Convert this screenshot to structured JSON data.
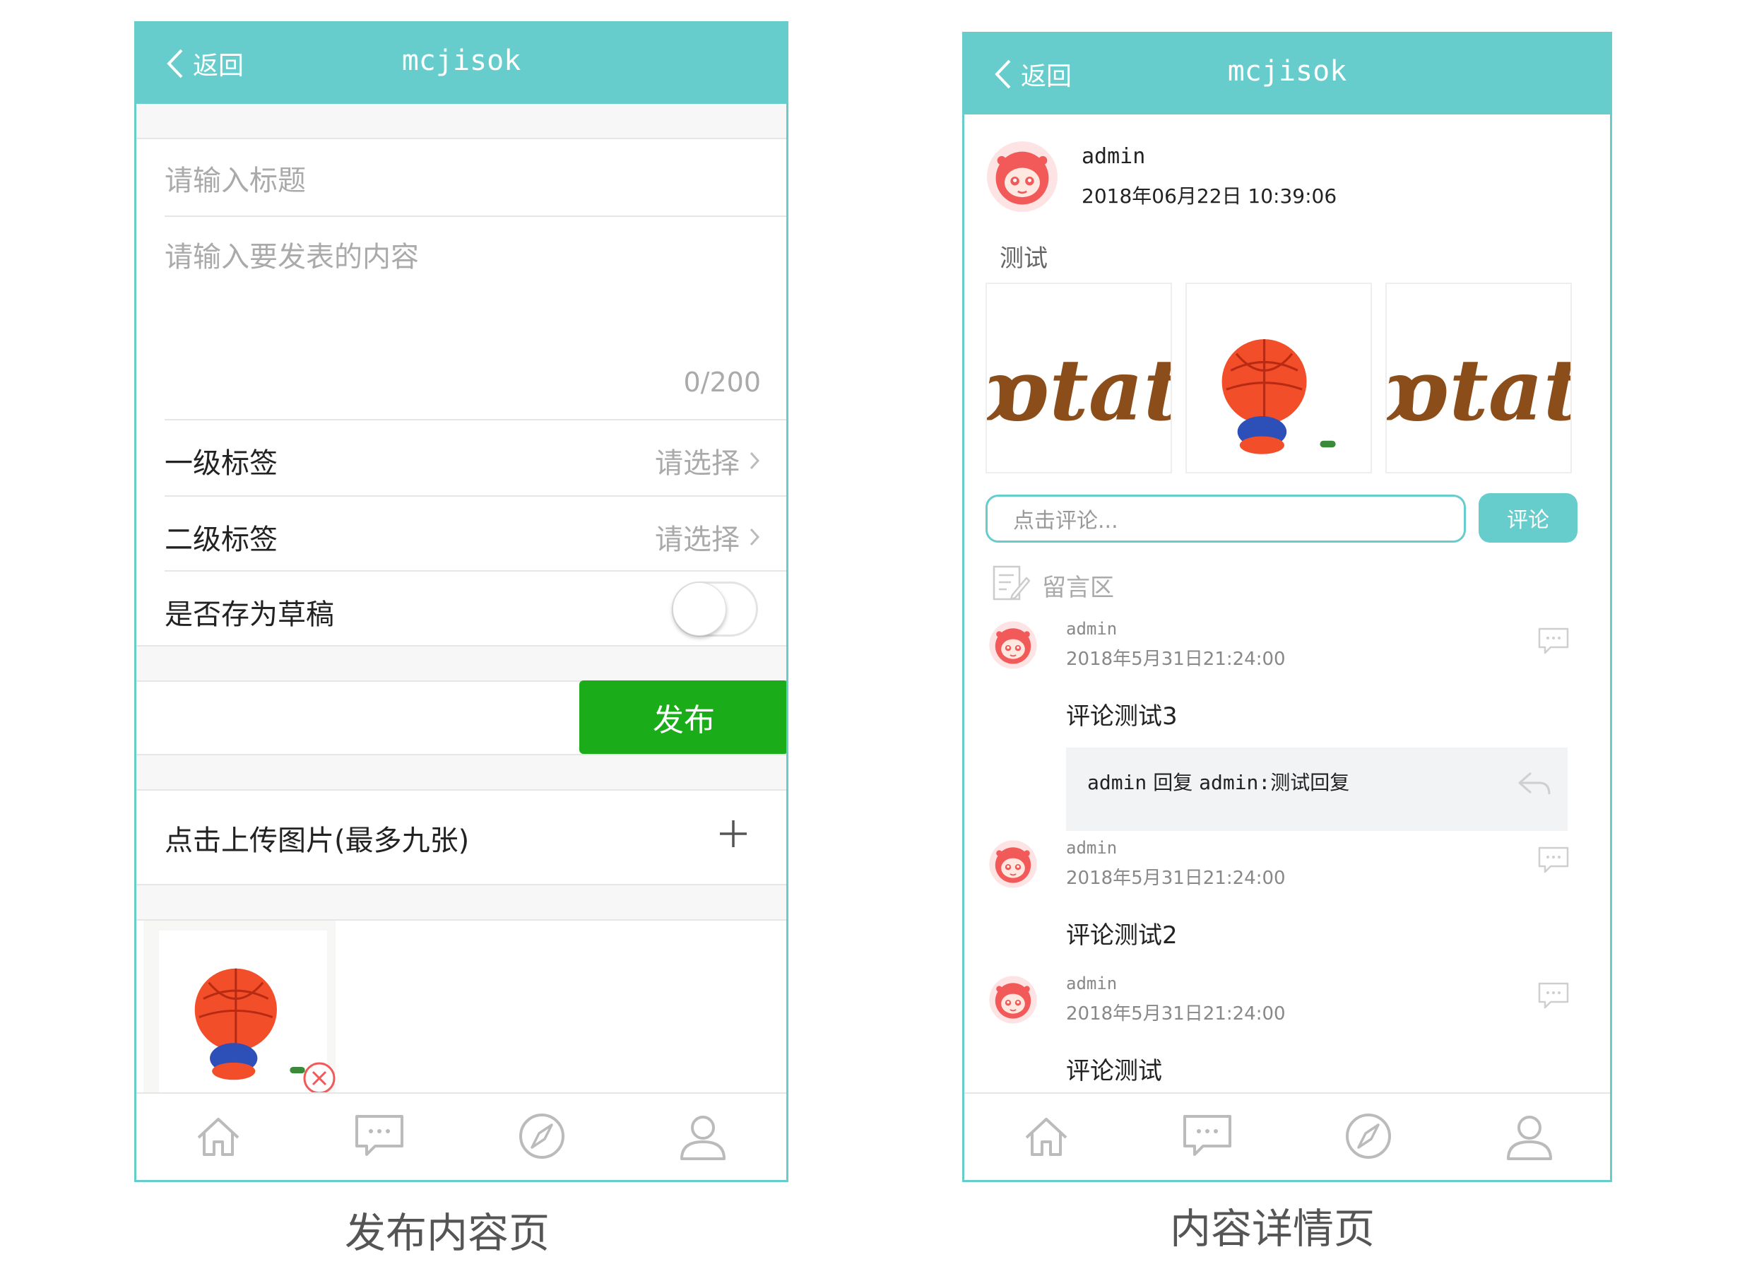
{
  "publish_page": {
    "header": {
      "back_label": "返回",
      "title": "mcjisok"
    },
    "title_placeholder": "请输入标题",
    "content_placeholder": "请输入要发表的内容",
    "char_count": "0/200",
    "level1_label": "一级标签",
    "level1_value": "请选择",
    "level2_label": "二级标签",
    "level2_value": "请选择",
    "draft_label": "是否存为草稿",
    "draft_on": false,
    "publish_button": "发布",
    "upload_label": "点击上传图片(最多九张)",
    "caption": "发布内容页"
  },
  "detail_page": {
    "header": {
      "back_label": "返回",
      "title": "mcjisok"
    },
    "post": {
      "author": "admin",
      "timestamp": "2018年06月22日 10:39:06",
      "text": "测试"
    },
    "comment_placeholder": "点击评论...",
    "comment_button": "评论",
    "section_title": "留言区",
    "comments": [
      {
        "user": "admin",
        "time": "2018年5月31日21:24:00",
        "text": "评论测试3",
        "reply": {
          "user": "admin",
          "action": "回复",
          "target": "admin:",
          "text": "测试回复"
        }
      },
      {
        "user": "admin",
        "time": "2018年5月31日21:24:00",
        "text": "评论测试2"
      },
      {
        "user": "admin",
        "time": "2018年5月31日21:24:00",
        "text": "评论测试"
      }
    ],
    "caption": "内容详情页"
  },
  "colors": {
    "accent": "#66cccc",
    "publish_green": "#1aad19"
  },
  "tabbar_icons": [
    "home-icon",
    "message-icon",
    "compass-icon",
    "user-icon"
  ]
}
